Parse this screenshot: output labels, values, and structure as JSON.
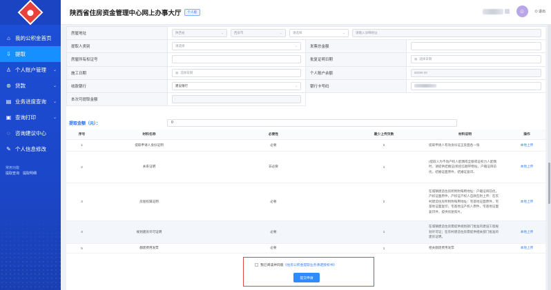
{
  "header": {
    "title": "陕西省住房资金管理中心网上办事大厅",
    "tag": "个人版",
    "logout": "退出"
  },
  "sidebar": {
    "items": [
      {
        "label": "我的公积金首页",
        "icon": "home-icon"
      },
      {
        "label": "提取",
        "icon": "withdraw-icon",
        "active": true
      },
      {
        "label": "个人账户管理",
        "icon": "user-icon",
        "caret": true
      },
      {
        "label": "贷款",
        "icon": "loan-icon",
        "caret": true
      },
      {
        "label": "业务进度查询",
        "icon": "progress-icon",
        "caret": true
      },
      {
        "label": "查询打印",
        "icon": "print-icon",
        "caret": true
      },
      {
        "label": "咨询建议中心",
        "icon": "chat-icon"
      },
      {
        "label": "个人信息修改",
        "icon": "settings-icon"
      }
    ],
    "quick": {
      "title": "常用功能",
      "links": [
        "提取查询",
        "提取明细"
      ]
    }
  },
  "form": {
    "house_address": {
      "label": "房屋地址",
      "sel1": "陕西省",
      "sel2": "西安市",
      "sel3": "请选择",
      "detail_placeholder": "请输入详细地址"
    },
    "withdrawer_type": {
      "label": "提取人类别",
      "placeholder": "请选择"
    },
    "invoice_amount": {
      "label": "发票总金额"
    },
    "property_cert": {
      "label": "房屋所有权证号"
    },
    "approval_date": {
      "label": "批复证明日期",
      "placeholder": "选择日期"
    },
    "construction_date": {
      "label": "施工日期",
      "placeholder": "选择日期"
    },
    "account_balance": {
      "label": "个人账户余额",
      "value": "68399.00"
    },
    "bank": {
      "label": "收款银行",
      "value": "建设银行"
    },
    "bank_card": {
      "label": "银行卡号码"
    },
    "withdrawable": {
      "label": "本次可提取金额"
    }
  },
  "amount": {
    "label": "提取金额（元）：",
    "value": "0"
  },
  "materials": {
    "headers": [
      "序号",
      "材料名称",
      "必要性",
      "最少上传页数",
      "材料说明",
      "操作"
    ],
    "rows": [
      {
        "no": "1",
        "name": "提取申请人身份证明",
        "need": "必要",
        "pages": "2",
        "desc": "提取申请人有效身份证正反面各一张",
        "op": "本地上传"
      },
      {
        "no": "2",
        "name": "关系证明",
        "need": "非必要",
        "pages": "1",
        "desc": "(提取人为不动产权人配偶或全额或证权力人配偶时，请提供结婚证)拆招信顺带物站，户籍证目前优，结婚证面原件，结婚证复印。",
        "op": "本地上传"
      },
      {
        "no": "3",
        "name": "房屋权属证明",
        "need": "必要",
        "pages": "2",
        "desc": "在城镇建造住房所附附每用地址：户籍证目前优，产权证面原件，产权证产权人自款在附上传：在农村建造住房所附附每用地址：宅基地证面原件，宅基地证面复印，宅基地证产权人原件，宅基地证面复印件，提供房屋照片。",
        "op": "本地上传"
      },
      {
        "no": "4",
        "name": "规划建房许可证明",
        "need": "必要",
        "pages": "1",
        "desc": "在城镇建造住房需提供规划部门批准的建设工程规划许可证；在农村建造住房需提供相关部门批准的建房证明。",
        "op": "本地上传"
      },
      {
        "no": "5",
        "name": "翻建费用发票",
        "need": "必要",
        "pages": "1",
        "desc": "相关翻建费用发票",
        "op": "本地上传"
      }
    ]
  },
  "submit": {
    "agree_text": "我已阅读并同意",
    "agree_link": "《住房公积金提取业务承诺授权书》",
    "button": "提交申请"
  },
  "colors": {
    "sidebar": "#1d4fd8",
    "active": "#1790ff",
    "link": "#2f7cf7",
    "highlight_border": "#e0463f",
    "button": "#2f8cff"
  }
}
